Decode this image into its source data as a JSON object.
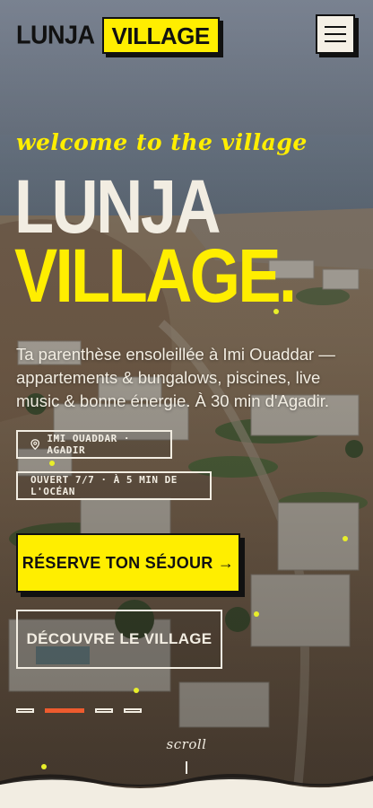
{
  "header": {
    "logo_part1": "LUNJA",
    "logo_part2": "VILLAGE",
    "menu_icon": "hamburger-icon"
  },
  "hero": {
    "welcome": "welcome to the village",
    "title_line1": "LUNJA",
    "title_line2": "VILLAGE",
    "title_stop": ".",
    "description": "Ta parenthèse ensoleillée à Imi Ouaddar — appartements & bungalows, piscines, live music & bonne énergie. À 30 min d'Agadir.",
    "location_icon": "location-pin-icon",
    "location_tag": "IMI OUADDAR · AGADIR",
    "hours_tag": "OUVERT 7/7 · À 5 MIN DE L'OCÉAN",
    "cta_primary": "RÉSERVE TON SÉJOUR →",
    "cta_secondary": "DÉCOUVRE LE VILLAGE",
    "slides": [
      {
        "active": false
      },
      {
        "active": true
      },
      {
        "active": false
      },
      {
        "active": false
      }
    ],
    "scroll": "scroll"
  },
  "colors": {
    "accent_yellow": "#ffee00",
    "accent_orange": "#ee5b2e",
    "cream": "#f2ede2",
    "ink": "#111111"
  }
}
